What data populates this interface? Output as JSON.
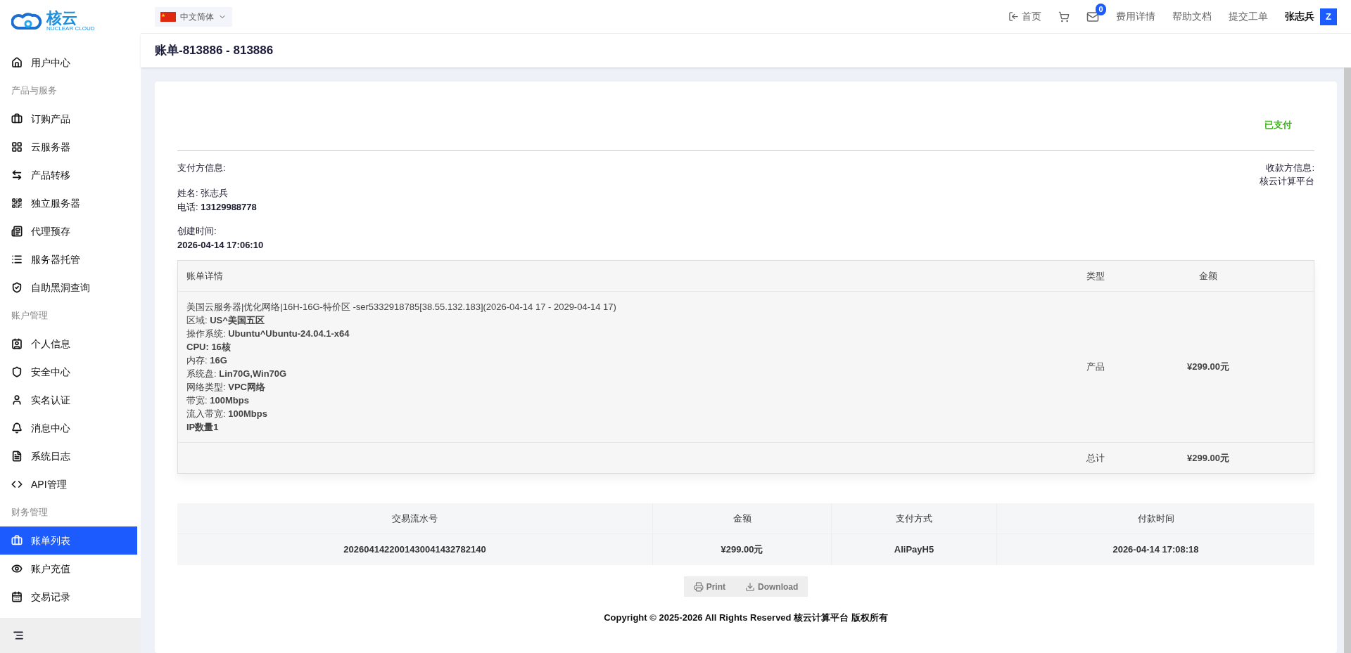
{
  "logo": {
    "text": "核云",
    "subtext": "NUCLEAR CLOUD"
  },
  "sidebar": {
    "items": [
      {
        "kind": "item",
        "label": "用户中心",
        "selected": false
      },
      {
        "kind": "section",
        "label": "产品与服务"
      },
      {
        "kind": "item",
        "label": "订购产品",
        "selected": false
      },
      {
        "kind": "item",
        "label": "云服务器",
        "selected": false
      },
      {
        "kind": "item",
        "label": "产品转移",
        "selected": false
      },
      {
        "kind": "item",
        "label": "独立服务器",
        "selected": false
      },
      {
        "kind": "item",
        "label": "代理预存",
        "selected": false
      },
      {
        "kind": "item",
        "label": "服务器托管",
        "selected": false
      },
      {
        "kind": "item",
        "label": "自助黑洞查询",
        "selected": false
      },
      {
        "kind": "section",
        "label": "账户管理"
      },
      {
        "kind": "item",
        "label": "个人信息",
        "selected": false
      },
      {
        "kind": "item",
        "label": "安全中心",
        "selected": false
      },
      {
        "kind": "item",
        "label": "实名认证",
        "selected": false
      },
      {
        "kind": "item",
        "label": "消息中心",
        "selected": false
      },
      {
        "kind": "item",
        "label": "系统日志",
        "selected": false
      },
      {
        "kind": "item",
        "label": "API管理",
        "selected": false
      },
      {
        "kind": "section",
        "label": "财务管理"
      },
      {
        "kind": "item",
        "label": "账单列表",
        "selected": true
      },
      {
        "kind": "item",
        "label": "账户充值",
        "selected": false
      },
      {
        "kind": "item",
        "label": "交易记录",
        "selected": false
      }
    ]
  },
  "topbar": {
    "language": "中文简体",
    "home": "首页",
    "mail_count": "0",
    "links": [
      "费用详情",
      "帮助文档",
      "提交工单"
    ],
    "user": "张志兵",
    "avatar": "Z"
  },
  "page_title": "账单-813886 - 813886",
  "invoice": {
    "status": "已支付",
    "payer_label": "支付方信息:",
    "payee_label": "收款方信息:",
    "payee": "核云计算平台",
    "name_label": "姓名:",
    "name": "张志兵",
    "phone_label": "电话:",
    "phone": "13129988778",
    "created_label": "创建时间:",
    "created": "2026-04-14 17:06:10",
    "table": {
      "columns": [
        "账单详情",
        "类型",
        "金额"
      ],
      "rows": [
        {
          "lines": [
            "美国云服务器|优化网络|16H-16G-特价区 -ser5332918785[38.55.132.183](2026-04-14 17 - 2029-04-14 17)",
            "区域: **US^美国五区**",
            "操作系统: **Ubuntu^Ubuntu-24.04.1-x64**",
            "**CPU: 16核**",
            "内存: **16G**",
            "系统盘: **Lin70G,Win70G**",
            "网络类型: **VPC网络**",
            "带宽: **100Mbps**",
            "流入带宽: **100Mbps**",
            "**IP数量1**"
          ],
          "type": "产品",
          "amount": "¥299.00元"
        }
      ],
      "total_label": "总计",
      "total": "¥299.00元"
    },
    "transactions": {
      "columns": [
        "交易流水号",
        "金额",
        "支付方式",
        "付款时间"
      ],
      "rows": [
        [
          "2026041422001430041432782140",
          "¥299.00元",
          "AliPayH5",
          "2026-04-14 17:08:18"
        ]
      ]
    },
    "buttons": [
      "Print",
      "Download"
    ]
  },
  "footer": "Copyright © 2025-2026 All Rights Reserved 核云计算平台 版权所有"
}
